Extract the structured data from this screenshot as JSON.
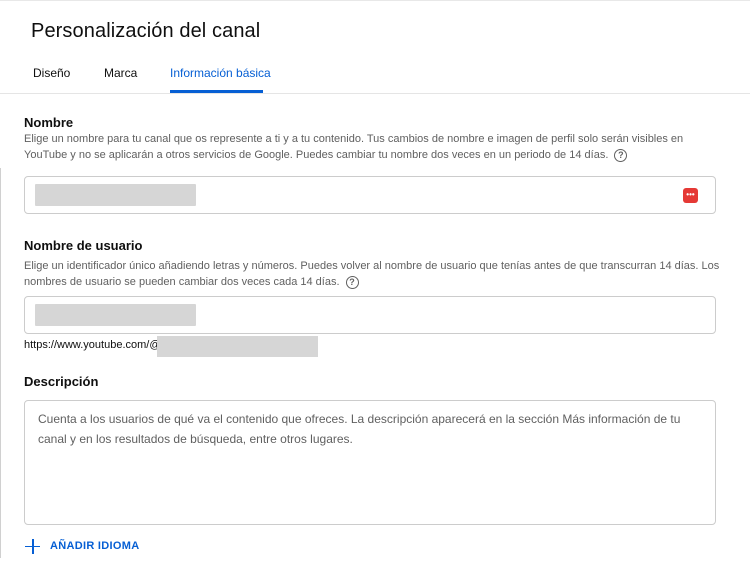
{
  "header": {
    "title": "Personalización del canal",
    "tabs": [
      {
        "label": "Diseño",
        "active": false
      },
      {
        "label": "Marca",
        "active": false
      },
      {
        "label": "Información básica",
        "active": true
      }
    ]
  },
  "name_section": {
    "title": "Nombre",
    "description": "Elige un nombre para tu canal que os represente a ti y a tu contenido. Tus cambios de nombre e imagen de perfil solo serán visibles en YouTube y no se aplicarán a otros servicios de Google. Puedes cambiar tu nombre dos veces en un periodo de 14 días.",
    "help_icon": "help-circle-icon",
    "field_value": "",
    "field_icon": "password-manager-icon"
  },
  "username_section": {
    "title": "Nombre de usuario",
    "description": "Elige un identificador único añadiendo letras y números. Puedes volver al nombre de usuario que tenías antes de que transcurran 14 días. Los nombres de usuario se pueden cambiar dos veces cada 14 días.",
    "help_icon": "help-circle-icon",
    "field_value": "",
    "url_prefix": "https://www.youtube.com/@"
  },
  "description_section": {
    "title": "Descripción",
    "placeholder": "Cuenta a los usuarios de qué va el contenido que ofreces. La descripción aparecerá en la sección Más información de tu canal y en los resultados de búsqueda, entre otros lugares."
  },
  "add_language": {
    "label": "AÑADIR IDIOMA",
    "icon": "plus-icon"
  },
  "colors": {
    "accent": "#065fd4",
    "text_primary": "#0f0f0f",
    "text_secondary": "#606060",
    "border": "#cccccc",
    "password_icon": "#e53935"
  }
}
